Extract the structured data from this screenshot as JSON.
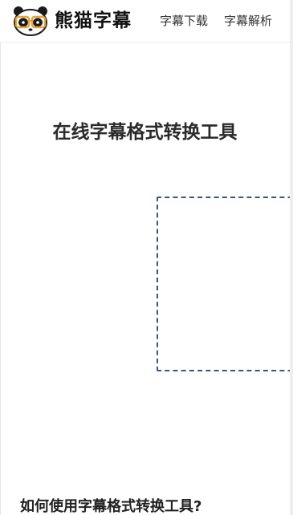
{
  "header": {
    "logo_text": "熊猫字幕",
    "nav": [
      {
        "label": "字幕下载"
      },
      {
        "label": "字幕解析"
      }
    ]
  },
  "main": {
    "title": "在线字幕格式转换工具",
    "howto_heading": "如何使用字幕格式转换工具?"
  },
  "colors": {
    "dropzone_border": "#3b5576",
    "logo_glasses": "#e8a33a"
  }
}
